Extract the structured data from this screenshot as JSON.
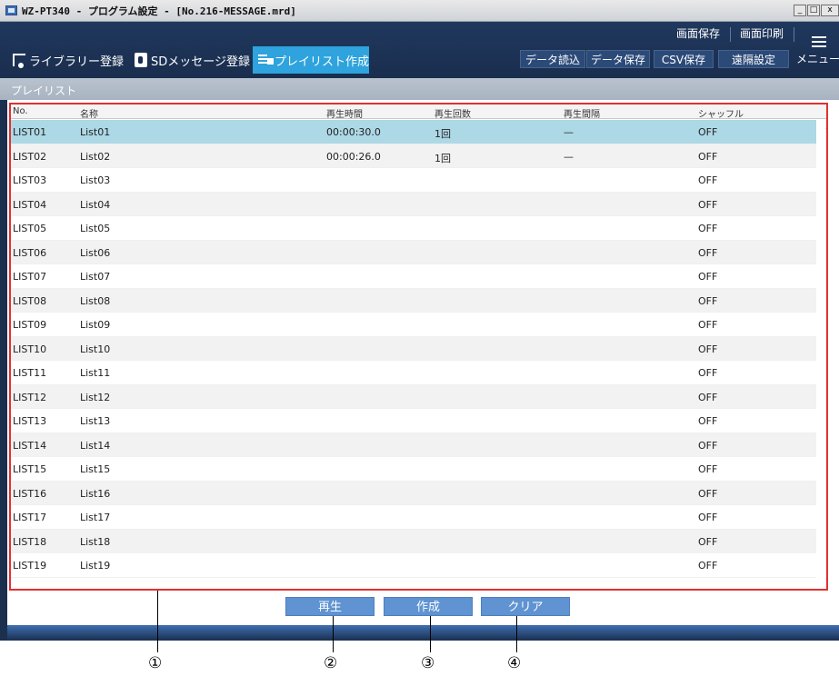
{
  "window": {
    "title": "WZ-PT340 - プログラム設定 - [No.216-MESSAGE.mrd]",
    "controls": [
      "_",
      "□",
      "x"
    ]
  },
  "tabs": [
    {
      "label": "ライブラリー登録",
      "icon": "library-icon"
    },
    {
      "label": "SDメッセージ登録",
      "icon": "sd-icon"
    },
    {
      "label": "プレイリスト作成",
      "icon": "playlist-icon"
    }
  ],
  "header_buttons": {
    "save_screen": "画面保存",
    "print_screen": "画面印刷",
    "read_data": "データ読込",
    "save_data": "データ保存",
    "csv_save": "CSV保存",
    "remote": "遠隔設定",
    "menu": "メニュー"
  },
  "section": {
    "title": "プレイリスト"
  },
  "table": {
    "columns": [
      "No.",
      "名称",
      "再生時間",
      "再生回数",
      "再生間隔",
      "シャッフル"
    ],
    "rows": [
      {
        "no": "LIST01",
        "name": "List01",
        "time": "00:00:30.0",
        "count": "1回",
        "interval": "—",
        "shuffle": "OFF"
      },
      {
        "no": "LIST02",
        "name": "List02",
        "time": "00:00:26.0",
        "count": "1回",
        "interval": "—",
        "shuffle": "OFF"
      },
      {
        "no": "LIST03",
        "name": "List03",
        "time": "",
        "count": "",
        "interval": "",
        "shuffle": "OFF"
      },
      {
        "no": "LIST04",
        "name": "List04",
        "time": "",
        "count": "",
        "interval": "",
        "shuffle": "OFF"
      },
      {
        "no": "LIST05",
        "name": "List05",
        "time": "",
        "count": "",
        "interval": "",
        "shuffle": "OFF"
      },
      {
        "no": "LIST06",
        "name": "List06",
        "time": "",
        "count": "",
        "interval": "",
        "shuffle": "OFF"
      },
      {
        "no": "LIST07",
        "name": "List07",
        "time": "",
        "count": "",
        "interval": "",
        "shuffle": "OFF"
      },
      {
        "no": "LIST08",
        "name": "List08",
        "time": "",
        "count": "",
        "interval": "",
        "shuffle": "OFF"
      },
      {
        "no": "LIST09",
        "name": "List09",
        "time": "",
        "count": "",
        "interval": "",
        "shuffle": "OFF"
      },
      {
        "no": "LIST10",
        "name": "List10",
        "time": "",
        "count": "",
        "interval": "",
        "shuffle": "OFF"
      },
      {
        "no": "LIST11",
        "name": "List11",
        "time": "",
        "count": "",
        "interval": "",
        "shuffle": "OFF"
      },
      {
        "no": "LIST12",
        "name": "List12",
        "time": "",
        "count": "",
        "interval": "",
        "shuffle": "OFF"
      },
      {
        "no": "LIST13",
        "name": "List13",
        "time": "",
        "count": "",
        "interval": "",
        "shuffle": "OFF"
      },
      {
        "no": "LIST14",
        "name": "List14",
        "time": "",
        "count": "",
        "interval": "",
        "shuffle": "OFF"
      },
      {
        "no": "LIST15",
        "name": "List15",
        "time": "",
        "count": "",
        "interval": "",
        "shuffle": "OFF"
      },
      {
        "no": "LIST16",
        "name": "List16",
        "time": "",
        "count": "",
        "interval": "",
        "shuffle": "OFF"
      },
      {
        "no": "LIST17",
        "name": "List17",
        "time": "",
        "count": "",
        "interval": "",
        "shuffle": "OFF"
      },
      {
        "no": "LIST18",
        "name": "List18",
        "time": "",
        "count": "",
        "interval": "",
        "shuffle": "OFF"
      },
      {
        "no": "LIST19",
        "name": "List19",
        "time": "",
        "count": "",
        "interval": "",
        "shuffle": "OFF"
      }
    ],
    "selected_index": 0
  },
  "footer_buttons": {
    "play": "再生",
    "create": "作成",
    "clear": "クリア"
  },
  "callouts": [
    "①",
    "②",
    "③",
    "④"
  ],
  "colors": {
    "header_bg": "#1b2f4f",
    "active_tab": "#2ea3dd",
    "selected_row": "#add8e6",
    "button_bg": "#5f93d1",
    "highlight_border": "#e23030"
  }
}
